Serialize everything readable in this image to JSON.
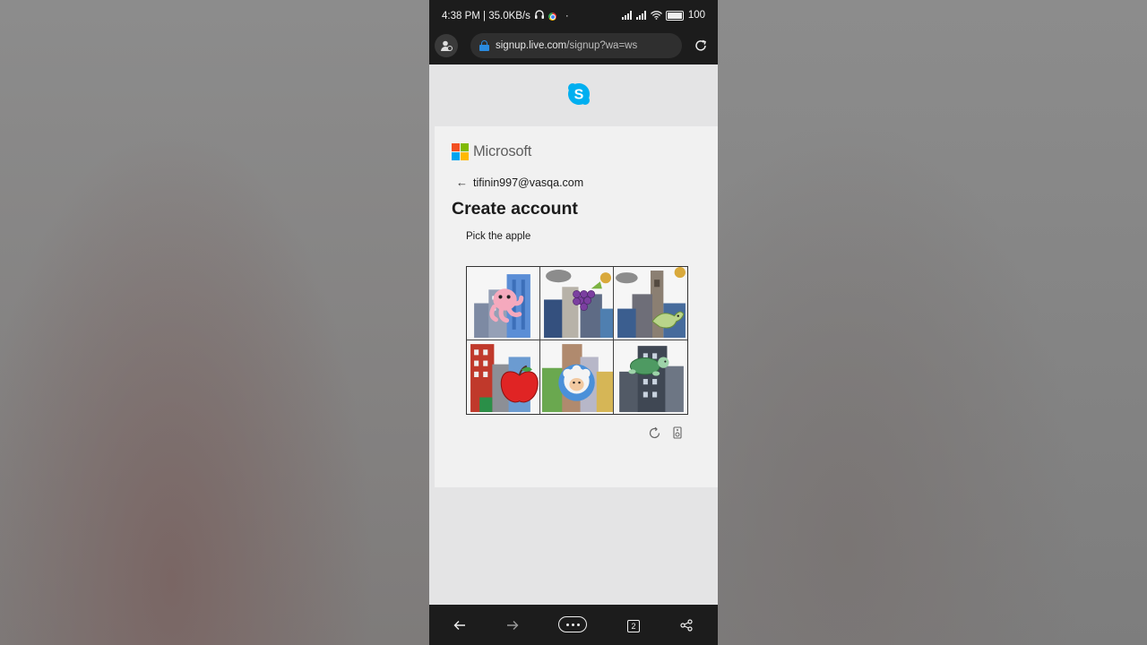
{
  "status_bar": {
    "time_speed": "4:38 PM | 35.0KB/s",
    "separator_dot": "·",
    "battery": "100"
  },
  "browser": {
    "url_host": "signup.live.com",
    "url_path": "/signup?wa=ws"
  },
  "signup": {
    "brand": "Microsoft",
    "email": "tifinin997@vasqa.com",
    "title": "Create account",
    "prompt": "Pick the apple",
    "tiles": [
      "octopus",
      "grapes",
      "dinosaur",
      "apple",
      "sheep",
      "turtle"
    ]
  },
  "bottom_nav": {
    "tab_count": "2"
  },
  "colors": {
    "ms_red": "#f25022",
    "ms_green": "#7fba00",
    "ms_blue": "#00a4ef",
    "ms_yellow": "#ffb900",
    "skype_blue": "#00aff0",
    "lock_blue": "#2a8be0"
  }
}
